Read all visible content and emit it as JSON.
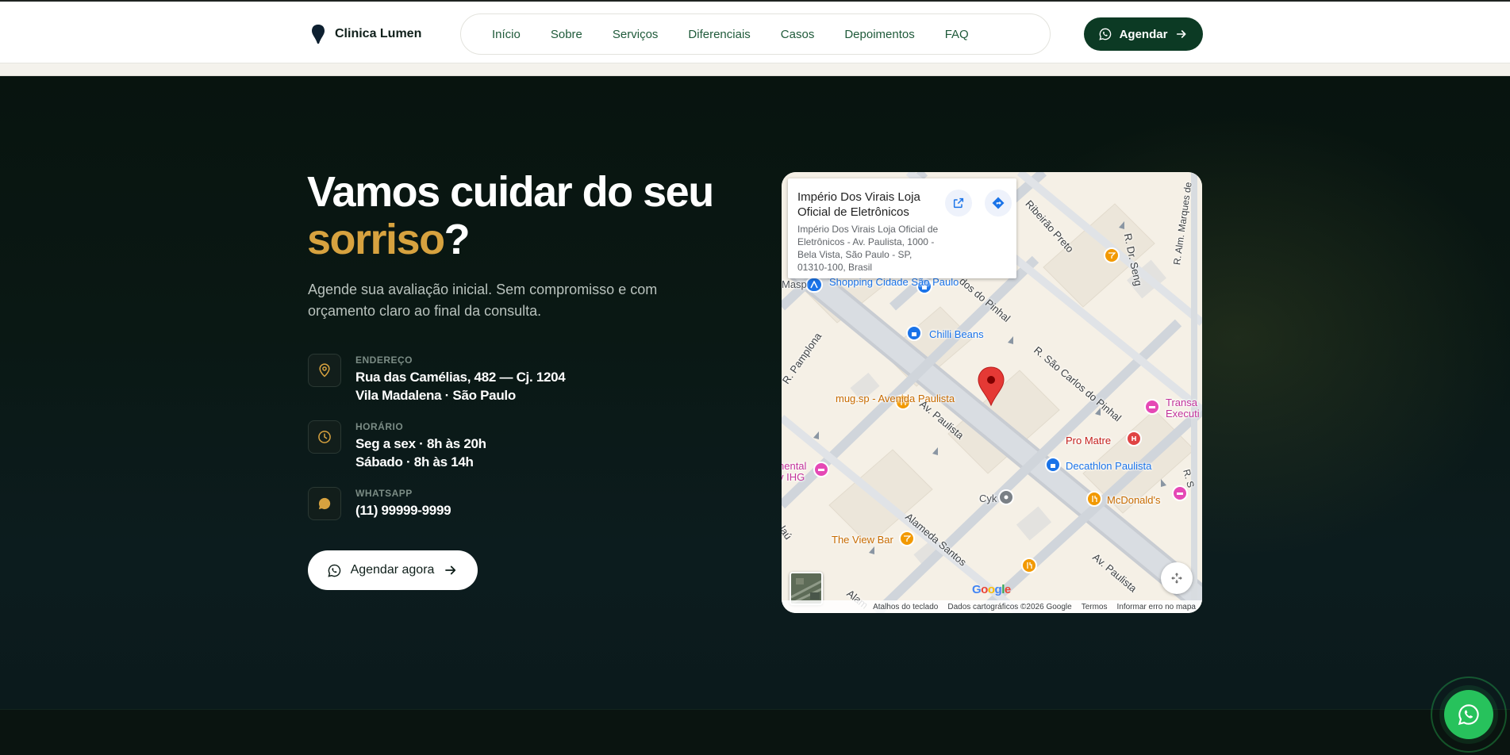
{
  "header": {
    "brand": "Clinica Lumen",
    "nav": [
      "Início",
      "Sobre",
      "Serviços",
      "Diferenciais",
      "Casos",
      "Depoimentos",
      "FAQ"
    ],
    "cta_label": "Agendar"
  },
  "hero": {
    "title_part1": "Vamos cuidar do seu",
    "title_accent": "sorriso",
    "title_end": "?",
    "subtitle": "Agende sua avaliação inicial. Sem compromisso e com orçamento claro ao final da consulta.",
    "address": {
      "label": "ENDEREÇO",
      "line1": "Rua das Camélias, 482 — Cj. 1204",
      "line2": "Vila Madalena · São Paulo"
    },
    "hours": {
      "label": "HORÁRIO",
      "line1": "Seg a sex · 8h às 20h",
      "line2": "Sábado · 8h às 14h"
    },
    "whatsapp": {
      "label": "WHATSAPP",
      "line1": "(11) 99999-9999"
    },
    "button_label": "Agendar agora"
  },
  "map": {
    "card_title": "Império Dos Virais Loja Oficial de Eletrônicos",
    "card_address": "Império Dos Virais Loja Oficial de Eletrônicos - Av. Paulista, 1000 - Bela Vista, São Paulo - SP, 01310-100, Brasil",
    "pois": {
      "shopping": "Shopping Cidade São Paulo",
      "masp": "Masp",
      "chilli": "Chilli Beans",
      "mug": "mug.sp - Avenida Paulista",
      "promatre": "Pro Matre",
      "decathlon": "Decathlon Paulista",
      "cyk": "Cyk",
      "mcdonalds": "McDonald's",
      "viewbar": "The View Bar",
      "transa": "Transa Executi",
      "mental": "nental y IHG"
    },
    "streets": {
      "paulista1": "Av. Paulista",
      "paulista2": "Av. Paulista",
      "pamplona": "R. Pamplona",
      "santos": "Alameda Santos",
      "saocarlos": "R. São Carlos do Pinhal",
      "pinhal": "dos do Pinhal",
      "ribeirao": "Ribeirão Preto",
      "seng": "R. Dr. Seng",
      "marques": "R. Alm. Marques de",
      "alam": "Alam",
      "lau": "laú",
      "r": "R. S"
    },
    "footer": [
      "Atalhos do teclado",
      "Dados cartográficos ©2026 Google",
      "Termos",
      "Informar erro no mapa"
    ],
    "google": "Google"
  },
  "colors": {
    "accent": "#d7a23f",
    "brand_green": "#0c3a24",
    "whatsapp": "#27c25c"
  }
}
